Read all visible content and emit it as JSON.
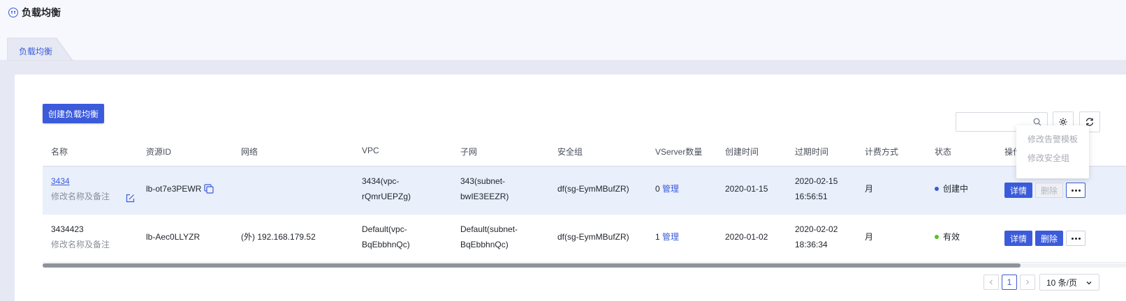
{
  "header": {
    "title": "负载均衡",
    "icon": "load-balancer-icon"
  },
  "tabs": [
    {
      "label": "负载均衡",
      "active": true
    }
  ],
  "toolbar": {
    "create_label": "创建负载均衡",
    "search_placeholder": "",
    "settings_icon": "gear-icon",
    "refresh_icon": "refresh-icon"
  },
  "table": {
    "columns": [
      "名称",
      "资源ID",
      "网络",
      "VPC",
      "子网",
      "安全组",
      "VServer数量",
      "创建时间",
      "过期时间",
      "计费方式",
      "状态",
      "操作"
    ],
    "rows": [
      {
        "name": "3434",
        "remark": "修改名称及备注",
        "resource_id": "lb-ot7e3PEWR",
        "network": "",
        "vpc_line1": "3434(vpc-",
        "vpc_line2": "rQmrUEPZg)",
        "subnet_line1": "343(subnet-",
        "subnet_line2": "bwIE3EEZR)",
        "security_group": "df(sg-EymMBufZR)",
        "vserver_count": "0",
        "manage": "管理",
        "created": "2020-01-15",
        "expire_date": "2020-02-15",
        "expire_time": "16:56:51",
        "billing": "月",
        "status": "创建中",
        "status_color": "#3b5bdb",
        "detail": "详情",
        "delete": "删除"
      },
      {
        "name": "3434423",
        "remark": "修改名称及备注",
        "resource_id": "lb-Aec0LLYZR",
        "network": "(外) 192.168.179.52",
        "vpc_line1": "Default(vpc-",
        "vpc_line2": "BqEbbhnQc)",
        "subnet_line1": "Default(subnet-",
        "subnet_line2": "BqEbbhnQc)",
        "security_group": "df(sg-EymMBufZR)",
        "vserver_count": "1",
        "manage": "管理",
        "created": "2020-01-02",
        "expire_date": "2020-02-02",
        "expire_time": "18:36:34",
        "billing": "月",
        "status": "有效",
        "status_color": "#52c41a",
        "detail": "详情",
        "delete": "删除"
      }
    ]
  },
  "dropdown": {
    "items": [
      "修改告警模板",
      "修改安全组"
    ]
  },
  "pagination": {
    "current_page": "1",
    "page_size": "10 条/页"
  }
}
